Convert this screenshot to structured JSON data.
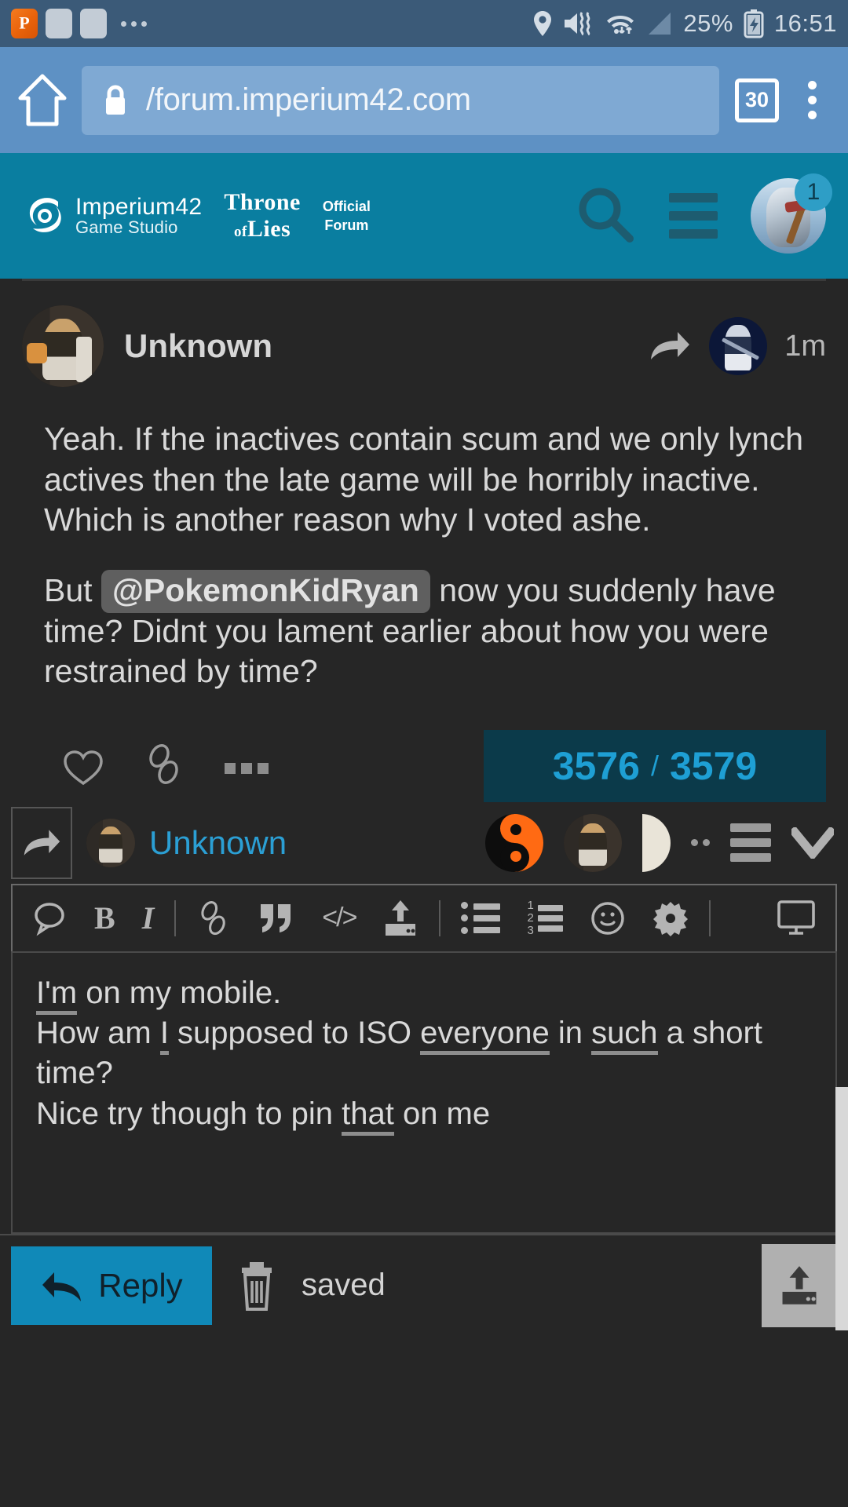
{
  "status_bar": {
    "app_icon": "pushbullet-icon",
    "notif_placeholder_1": "notification-icon",
    "notif_placeholder_2": "notification-icon",
    "overflow": "more-notifications-icon",
    "icons": [
      "location-icon",
      "mute-vibrate-icon",
      "wifi-icon",
      "signal-icon"
    ],
    "battery_percent": "25%",
    "battery_state": "charging-battery-icon",
    "time": "16:51"
  },
  "browser": {
    "home_icon": "home-icon",
    "lock_icon": "padlock-icon",
    "url": "/forum.imperium42.com",
    "tab_count": "30",
    "menu_icon": "overflow-menu-icon"
  },
  "forum_header": {
    "studio_name": "Imperium42",
    "studio_sub": "Game Studio",
    "game_line1": "Throne",
    "game_line2_small": "of",
    "game_line2": "Lies",
    "official_line1": "Official",
    "official_line2": "Forum",
    "search_icon": "search-icon",
    "menu_icon": "hamburger-menu-icon",
    "avatar": "user-avatar",
    "notification_count": "1"
  },
  "post": {
    "author": "Unknown",
    "author_avatar": "author-avatar",
    "reply_icon": "reply-arrow-icon",
    "replied_to_avatar": "replied-to-avatar",
    "timestamp": "1m",
    "paragraph_1": "Yeah. If the inactives contain scum and we only lynch actives then the late game will be horribly inactive. Which is another reason why I voted ashe.",
    "paragraph_2_before": "But",
    "mention": "@PokemonKidRyan",
    "paragraph_2_after": "now you suddenly have time? Didnt you lament earlier about how you were restrained by time?",
    "actions": {
      "like_icon": "heart-icon",
      "link_icon": "link-chain-icon",
      "more_icon": "more-actions-icon"
    },
    "counter": {
      "current": "3576",
      "separator": "/",
      "total": "3579"
    }
  },
  "reply_context": {
    "share_icon": "share-arrow-icon",
    "mini_avatar": "mini-avatar",
    "name": "Unknown",
    "yinyang_icon": "yin-yang-avatar",
    "avatar_2": "avatar-thumb",
    "avatar_3": "avatar-thumb-partial",
    "more_icon": "more-participants-icon",
    "list_icon": "post-list-icon",
    "collapse_icon": "chevron-down-icon"
  },
  "editor": {
    "toolbar": [
      {
        "name": "quote-reply-icon",
        "label": "speech-bubble"
      },
      {
        "name": "bold-button",
        "label": "B"
      },
      {
        "name": "italic-button",
        "label": "I"
      },
      {
        "name": "link-button",
        "label": "link"
      },
      {
        "name": "blockquote-button",
        "label": "”"
      },
      {
        "name": "code-button",
        "label": "</>"
      },
      {
        "name": "upload-button",
        "label": "upload"
      },
      {
        "name": "bulleted-list-button",
        "label": "ul"
      },
      {
        "name": "numbered-list-button",
        "label": "ol"
      },
      {
        "name": "emoji-button",
        "label": "smiley"
      },
      {
        "name": "settings-button",
        "label": "gear"
      },
      {
        "name": "preview-button",
        "label": "monitor"
      }
    ],
    "code_label": "</>",
    "bold_label": "B",
    "italic_label": "I",
    "list_numbers": [
      "1",
      "2",
      "3"
    ],
    "content_lines": [
      {
        "id": "l1",
        "parts": [
          {
            "t": "I'm",
            "sp": true
          },
          {
            "t": " on my mobile.",
            "sp": false
          }
        ]
      },
      {
        "id": "l2",
        "parts": [
          {
            "t": "How am ",
            "sp": false
          },
          {
            "t": "I",
            "sp": true
          },
          {
            "t": " supposed to ISO ",
            "sp": false
          },
          {
            "t": "everyone",
            "sp": true
          },
          {
            "t": " in ",
            "sp": false
          },
          {
            "t": "such",
            "sp": true
          },
          {
            "t": " a short time?",
            "sp": false
          }
        ]
      },
      {
        "id": "l3",
        "parts": [
          {
            "t": "Nice try though to pin ",
            "sp": false
          },
          {
            "t": "that",
            "sp": true
          },
          {
            "t": " on me",
            "sp": false
          }
        ]
      }
    ]
  },
  "bottom_bar": {
    "reply_icon": "reply-arrow-icon",
    "reply_label": "Reply",
    "delete_icon": "trash-icon",
    "status_text": "saved",
    "upload_icon": "upload-icon"
  },
  "colors": {
    "status_bar_bg": "#3b5a78",
    "browser_bg": "#5e91c4",
    "forum_teal": "#0a7ea0",
    "page_bg": "#262626",
    "accent_blue": "#1e9fd4",
    "reply_btn": "#1089b8",
    "counter_bg": "#0b3a4a",
    "mention_bg": "#5f5f5f"
  }
}
